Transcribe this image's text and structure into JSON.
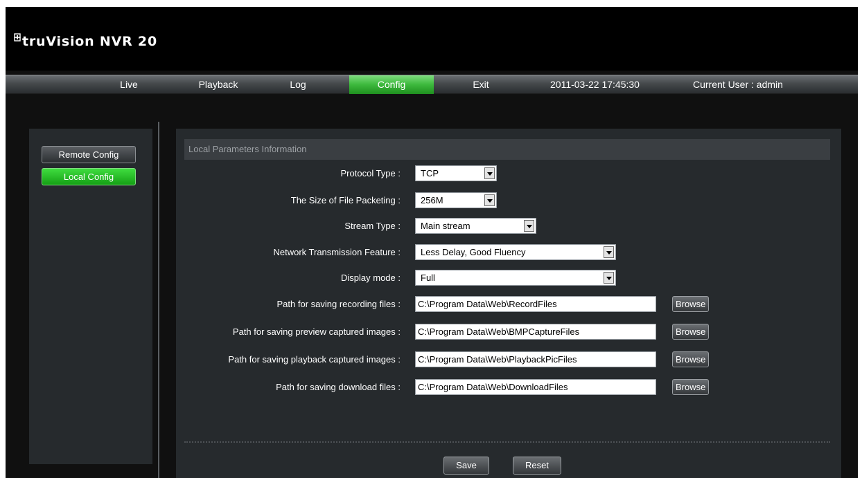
{
  "app": {
    "logo_text": "truVision NVR 20"
  },
  "nav": {
    "items": [
      {
        "label": "Live"
      },
      {
        "label": "Playback"
      },
      {
        "label": "Log"
      },
      {
        "label": "Config"
      },
      {
        "label": "Exit"
      }
    ],
    "active": "Config",
    "datetime": "2011-03-22 17:45:30",
    "current_user": "Current User : admin"
  },
  "sidebar": {
    "items": [
      {
        "label": "Remote Config",
        "active": false
      },
      {
        "label": "Local Config",
        "active": true
      }
    ]
  },
  "panel": {
    "title": "Local Parameters Information",
    "fields": {
      "protocol_type": {
        "label": "Protocol Type :",
        "value": "TCP"
      },
      "file_packet_size": {
        "label": "The Size of File Packeting :",
        "value": "256M"
      },
      "stream_type": {
        "label": "Stream Type :",
        "value": "Main stream"
      },
      "network_feature": {
        "label": "Network Transmission Feature :",
        "value": "Less Delay, Good Fluency"
      },
      "display_mode": {
        "label": "Display mode :",
        "value": "Full"
      },
      "record_path": {
        "label": "Path for saving recording files :",
        "value": "C:\\Program Data\\Web\\RecordFiles"
      },
      "preview_path": {
        "label": "Path for saving preview captured images :",
        "value": "C:\\Program Data\\Web\\BMPCaptureFiles"
      },
      "playback_path": {
        "label": "Path for saving playback captured images :",
        "value": "C:\\Program Data\\Web\\PlaybackPicFiles"
      },
      "download_path": {
        "label": "Path for saving download files :",
        "value": "C:\\Program Data\\Web\\DownloadFiles"
      }
    },
    "browse_label": "Browse",
    "save_label": "Save",
    "reset_label": "Reset"
  },
  "colors": {
    "active_green": "#3cb83c",
    "panel_bg": "#262a2d",
    "header_bg": "#000000"
  }
}
